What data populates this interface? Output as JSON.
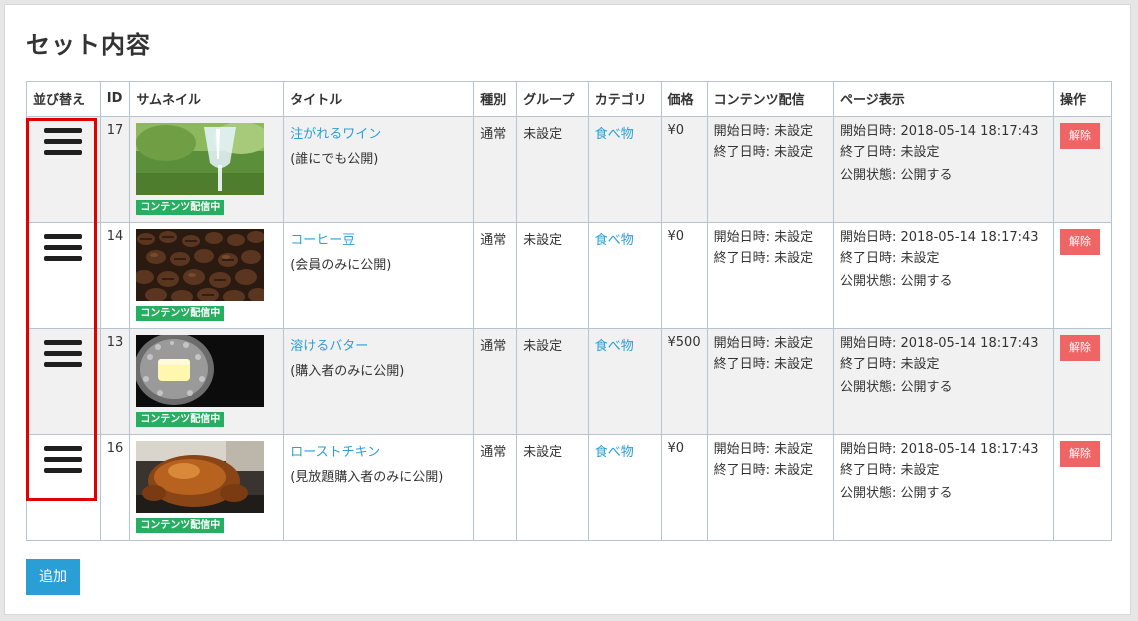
{
  "page": {
    "title": "セット内容"
  },
  "table": {
    "headers": {
      "sort": "並び替え",
      "id": "ID",
      "thumbnail": "サムネイル",
      "title": "タイトル",
      "kind": "種別",
      "group": "グループ",
      "category": "カテゴリ",
      "price": "価格",
      "delivery": "コンテンツ配信",
      "display": "ページ表示",
      "actions": "操作"
    },
    "rows": [
      {
        "id": "17",
        "title": "注がれるワイン",
        "visibility": "(誰にでも公開)",
        "badge": "コンテンツ配信中",
        "kind": "通常",
        "group": "未設定",
        "category": "食べ物",
        "price": "¥0",
        "delivery_start": "開始日時: 未設定",
        "delivery_end": "終了日時: 未設定",
        "display_start": "開始日時: 2018-05-14 18:17:43",
        "display_end": "終了日時: 未設定",
        "display_status": "公開状態: 公開する",
        "action": "解除"
      },
      {
        "id": "14",
        "title": "コーヒー豆",
        "visibility": "(会員のみに公開)",
        "badge": "コンテンツ配信中",
        "kind": "通常",
        "group": "未設定",
        "category": "食べ物",
        "price": "¥0",
        "delivery_start": "開始日時: 未設定",
        "delivery_end": "終了日時: 未設定",
        "display_start": "開始日時: 2018-05-14 18:17:43",
        "display_end": "終了日時: 未設定",
        "display_status": "公開状態: 公開する",
        "action": "解除"
      },
      {
        "id": "13",
        "title": "溶けるバター",
        "visibility": "(購入者のみに公開)",
        "badge": "コンテンツ配信中",
        "kind": "通常",
        "group": "未設定",
        "category": "食べ物",
        "price": "¥500",
        "delivery_start": "開始日時: 未設定",
        "delivery_end": "終了日時: 未設定",
        "display_start": "開始日時: 2018-05-14 18:17:43",
        "display_end": "終了日時: 未設定",
        "display_status": "公開状態: 公開する",
        "action": "解除"
      },
      {
        "id": "16",
        "title": "ローストチキン",
        "visibility": "(見放題購入者のみに公開)",
        "badge": "コンテンツ配信中",
        "kind": "通常",
        "group": "未設定",
        "category": "食べ物",
        "price": "¥0",
        "delivery_start": "開始日時: 未設定",
        "delivery_end": "終了日時: 未設定",
        "display_start": "開始日時: 2018-05-14 18:17:43",
        "display_end": "終了日時: 未設定",
        "display_status": "公開状態: 公開する",
        "action": "解除"
      }
    ]
  },
  "add_button": "追加",
  "colors": {
    "link": "#2a9fd6",
    "badge": "#27ae60",
    "release": "#ef6464",
    "add": "#2a9fd6",
    "highlight": "#e00000"
  }
}
